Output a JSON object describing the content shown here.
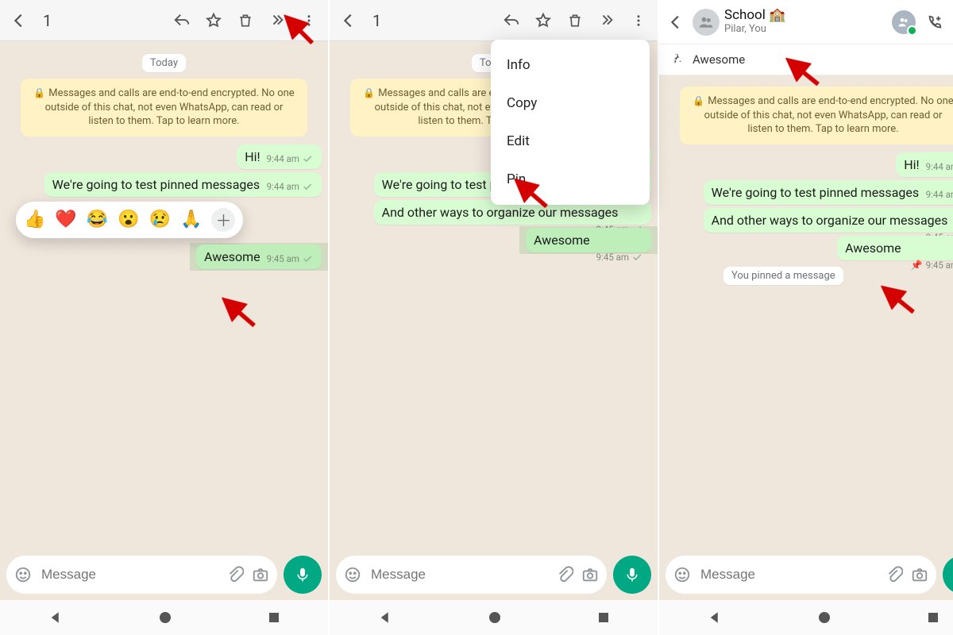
{
  "selection_count": "1",
  "date_chip": "Today",
  "e2e_text": "Messages and calls are end-to-end encrypted. No one outside of this chat, not even WhatsApp, can read or listen to them. Tap to learn more.",
  "messages": {
    "hi": {
      "text": "Hi!",
      "time": "9:44 am"
    },
    "test": {
      "text": "We're going to test pinned messages",
      "time": "9:44 am"
    },
    "organize": {
      "text": "And other ways to organize our messages",
      "time": "9:45 am"
    },
    "awesome": {
      "text": "Awesome",
      "time": "9:45 am"
    }
  },
  "reactions": [
    "👍",
    "❤️",
    "😂",
    "😮",
    "😢",
    "🙏"
  ],
  "menu": {
    "info": "Info",
    "copy": "Copy",
    "edit": "Edit",
    "pin": "Pin"
  },
  "group": {
    "name": "School 🏫",
    "members": "Pilar, You"
  },
  "pinned_text": "Awesome",
  "system_pin": "You pinned a message",
  "compose_placeholder": "Message"
}
